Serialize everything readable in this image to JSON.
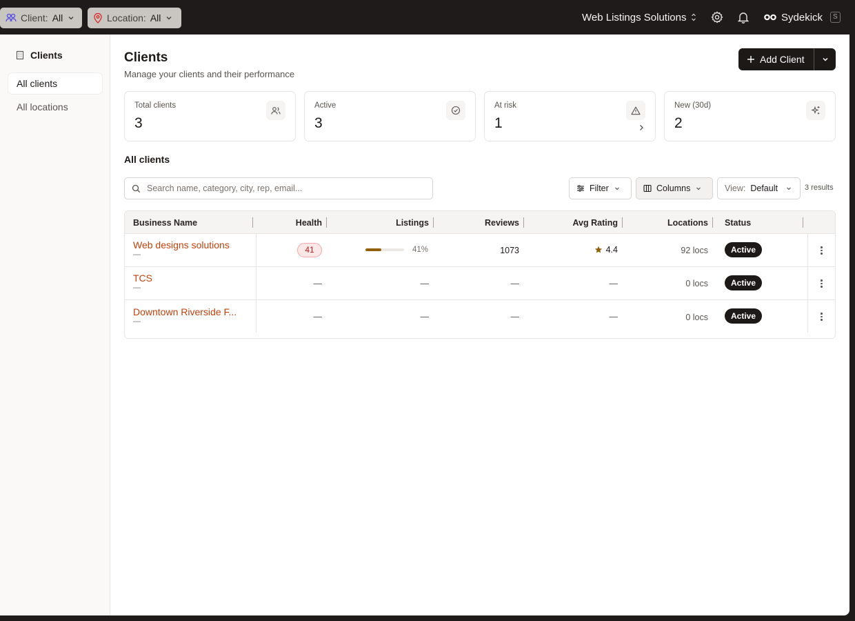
{
  "topbar": {
    "client_filter": {
      "label": "Client:",
      "value": "All"
    },
    "location_filter": {
      "label": "Location:",
      "value": "All"
    },
    "workspace": "Web Listings Solutions",
    "user": "Sydekick",
    "user_shortcut": "S"
  },
  "sidebar": {
    "header": "Clients",
    "items": [
      {
        "label": "All clients",
        "active": true
      },
      {
        "label": "All locations",
        "active": false
      }
    ]
  },
  "page": {
    "title": "Clients",
    "subtitle": "Manage your clients and their performance",
    "add_button": "Add Client"
  },
  "stats": [
    {
      "label": "Total clients",
      "value": "3",
      "icon": "users-icon"
    },
    {
      "label": "Active",
      "value": "3",
      "icon": "check-circle-icon"
    },
    {
      "label": "At risk",
      "value": "1",
      "icon": "warning-icon"
    },
    {
      "label": "New (30d)",
      "value": "2",
      "icon": "sparkle-icon"
    }
  ],
  "section_title": "All clients",
  "toolbar": {
    "search_placeholder": "Search name, category, city, rep, email...",
    "filter_label": "Filter",
    "columns_label": "Columns",
    "view_label": "View:",
    "view_value": "Default",
    "results": "3 results"
  },
  "table": {
    "columns": [
      "Business Name",
      "Health",
      "Listings",
      "Reviews",
      "Avg Rating",
      "Locations",
      "Status"
    ],
    "rows": [
      {
        "name": "Web designs solutions",
        "sub": "—",
        "health": "41",
        "listings_pct": 41,
        "listings": "41%",
        "reviews": "1073",
        "rating": "4.4",
        "locations": "92 locs",
        "status": "Active"
      },
      {
        "name": "TCS",
        "sub": "—",
        "health": "—",
        "listings": "—",
        "reviews": "—",
        "rating": "—",
        "locations": "0 locs",
        "status": "Active"
      },
      {
        "name": "Downtown Riverside F...",
        "sub": "—",
        "health": "—",
        "listings": "—",
        "reviews": "—",
        "rating": "—",
        "locations": "0 locs",
        "status": "Active"
      }
    ]
  },
  "colors": {
    "accent_link": "#c2410c",
    "dark": "#1c1917",
    "health_bad": "#b91c1c",
    "listings_fill": "#92600a"
  }
}
